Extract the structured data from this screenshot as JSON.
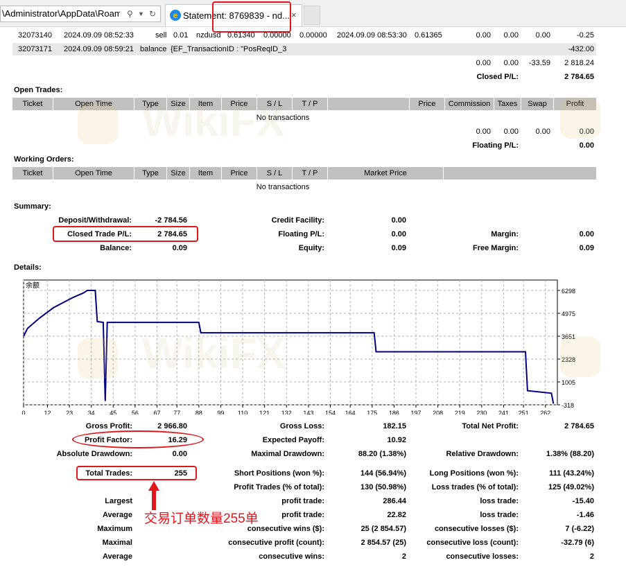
{
  "browser": {
    "address_text": "\\Administrator\\AppData\\Roam",
    "tab_title": "Statement: 8769839 - nd...",
    "close_glyph": "×",
    "icons": [
      "search-icon",
      "dropdown-icon",
      "refresh-icon",
      "ie-icon",
      "close-icon"
    ]
  },
  "deals_rows": [
    [
      "32073140",
      "2024.09.09 08:52:33",
      "sell",
      "0.01",
      "nzdusd",
      "0.61340",
      "0.00000",
      "0.00000",
      "2024.09.09 08:53:30",
      "0.61365",
      "0.00",
      "0.00",
      "0.00",
      "-0.25"
    ],
    [
      "32073171",
      "2024.09.09 08:59:21",
      "balance",
      "{EF_TransactionID : \"PosReqID_3",
      "-432.00"
    ]
  ],
  "deals_totals": [
    "0.00",
    "0.00",
    "-33.59",
    "2 818.24"
  ],
  "deals_closed_pl": {
    "label": "Closed P/L:",
    "value": "2 784.65"
  },
  "open_trades": {
    "title": "Open Trades:",
    "headers": [
      "Ticket",
      "Open Time",
      "Type",
      "Size",
      "Item",
      "Price",
      "S / L",
      "T / P",
      "Price",
      "Commission",
      "Taxes",
      "Swap",
      "Profit"
    ],
    "empty": "No transactions",
    "totals": [
      "0.00",
      "0.00",
      "0.00",
      "0.00"
    ],
    "floating_label": "Floating P/L:",
    "floating_value": "0.00"
  },
  "working_orders": {
    "title": "Working Orders:",
    "headers": [
      "Ticket",
      "Open Time",
      "Type",
      "Size",
      "Item",
      "Price",
      "S / L",
      "T / P",
      "Market Price"
    ],
    "empty": "No transactions"
  },
  "summary": {
    "title": "Summary:",
    "deposit_label": "Deposit/Withdrawal:",
    "deposit_value": "-2 784.56",
    "closed_label": "Closed Trade P/L:",
    "closed_value": "2 784.65",
    "balance_label": "Balance:",
    "balance_value": "0.09",
    "credit_label": "Credit Facility:",
    "credit_value": "0.00",
    "floating_label": "Floating P/L:",
    "floating_value": "0.00",
    "equity_label": "Equity:",
    "equity_value": "0.09",
    "margin_label": "Margin:",
    "margin_value": "0.00",
    "free_margin_label": "Free Margin:",
    "free_margin_value": "0.09"
  },
  "details": {
    "title": "Details:"
  },
  "chart_data": {
    "type": "line",
    "title": "余额",
    "series": [
      {
        "values": [
          [
            0,
            3651
          ],
          [
            2,
            4100
          ],
          [
            8,
            4700
          ],
          [
            15,
            5300
          ],
          [
            25,
            5900
          ],
          [
            30,
            6150
          ],
          [
            32,
            6298
          ],
          [
            36,
            6298
          ],
          [
            37,
            4500
          ],
          [
            40,
            4450
          ],
          [
            41,
            -100
          ],
          [
            42,
            4450
          ],
          [
            88,
            4450
          ],
          [
            89,
            3850
          ],
          [
            176,
            3850
          ],
          [
            177,
            2750
          ],
          [
            252,
            2750
          ],
          [
            253,
            500
          ],
          [
            265,
            350
          ],
          [
            266,
            -250
          ]
        ]
      }
    ],
    "xticks": [
      "0",
      "12",
      "23",
      "34",
      "45",
      "56",
      "67",
      "77",
      "88",
      "99",
      "110",
      "121",
      "132",
      "143",
      "154",
      "164",
      "175",
      "186",
      "197",
      "208",
      "219",
      "230",
      "241",
      "251",
      "262"
    ],
    "yticks": [
      "6298",
      "4975",
      "3651",
      "2328",
      "1005",
      "-318"
    ],
    "xlim": [
      0,
      268
    ],
    "ylim": [
      -318,
      6900
    ],
    "line_color": "#000080"
  },
  "stats": [
    {
      "l1": "Gross Profit:",
      "v1": "2 966.80",
      "l2": "Gross Loss:",
      "v2": "182.15",
      "l3": "Total Net Profit:",
      "v3": "2 784.65"
    },
    {
      "l1": "Profit Factor:",
      "v1": "16.29",
      "l2": "Expected Payoff:",
      "v2": "10.92",
      "l3": "",
      "v3": ""
    },
    {
      "l1": "Absolute Drawdown:",
      "v1": "0.00",
      "l2": "Maximal Drawdown:",
      "v2": "88.20 (1.38%)",
      "l3": "Relative Drawdown:",
      "v3": "1.38% (88.20)"
    },
    {
      "l1": "Total Trades:",
      "v1": "255",
      "l2": "Short Positions (won %):",
      "v2": "144 (56.94%)",
      "l3": "Long Positions (won %):",
      "v3": "111 (43.24%)"
    },
    {
      "l1": "",
      "v1": "",
      "l2": "Profit Trades (% of total):",
      "v2": "130 (50.98%)",
      "l3": "Loss trades (% of total):",
      "v3": "125 (49.02%)"
    },
    {
      "l1": "Largest",
      "v1": "",
      "l2": "profit trade:",
      "v2": "286.44",
      "l3": "loss trade:",
      "v3": "-15.40"
    },
    {
      "l1": "Average",
      "v1": "",
      "l2": "profit trade:",
      "v2": "22.82",
      "l3": "loss trade:",
      "v3": "-1.46"
    },
    {
      "l1": "Maximum",
      "v1": "",
      "l2": "consecutive wins ($):",
      "v2": "25 (2 854.57)",
      "l3": "consecutive losses ($):",
      "v3": "7 (-6.22)"
    },
    {
      "l1": "Maximal",
      "v1": "",
      "l2": "consecutive profit (count):",
      "v2": "2 854.57 (25)",
      "l3": "consecutive loss (count):",
      "v3": "-32.79 (6)"
    },
    {
      "l1": "Average",
      "v1": "",
      "l2": "consecutive wins:",
      "v2": "2",
      "l3": "consecutive losses:",
      "v3": "2"
    }
  ],
  "annotation": {
    "text": "交易订单数量255单",
    "color": "#e0161d"
  },
  "watermark": {
    "text": "WikiFX"
  }
}
